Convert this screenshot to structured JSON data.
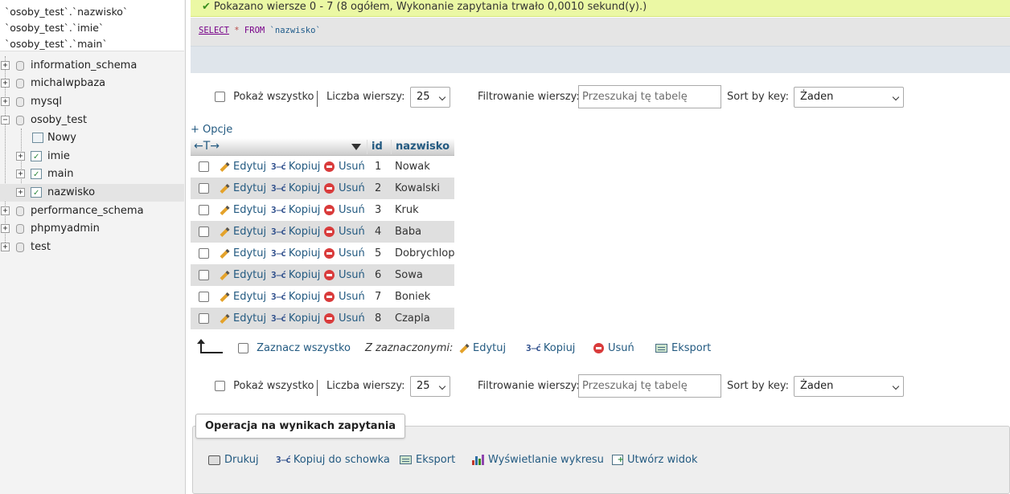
{
  "recent": [
    "`osoby_test`.`nazwisko`",
    "`osoby_test`.`imie`",
    "`osoby_test`.`main`"
  ],
  "tree": {
    "databases": [
      "information_schema",
      "michalwpbaza",
      "mysql",
      "osoby_test",
      "performance_schema",
      "phpmyadmin",
      "test"
    ],
    "new_label": "Nowy",
    "tables": [
      "imie",
      "main",
      "nazwisko"
    ]
  },
  "message": "Pokazano wiersze 0 - 7 (8 ogółem, Wykonanie zapytania trwało 0,0010 sekund(y).)",
  "sql": {
    "select": "SELECT",
    "star": "*",
    "from": "FROM",
    "table": "`nazwisko`"
  },
  "toolbar": {
    "show_all": "Pokaż wszystko",
    "rows_label": "Liczba wierszy:",
    "rows_value": "25",
    "filter_label": "Filtrowanie wierszy:",
    "filter_placeholder": "Przeszukaj tę tabelę",
    "sort_label": "Sort by key:",
    "sort_value": "Żaden"
  },
  "options_link": "+ Opcje",
  "table": {
    "columns": [
      "id",
      "nazwisko"
    ],
    "actions": {
      "edit": "Edytuj",
      "copy": "Kopiuj",
      "delete": "Usuń"
    },
    "rows": [
      {
        "id": "1",
        "nazwisko": "Nowak"
      },
      {
        "id": "2",
        "nazwisko": "Kowalski"
      },
      {
        "id": "3",
        "nazwisko": "Kruk"
      },
      {
        "id": "4",
        "nazwisko": "Baba"
      },
      {
        "id": "5",
        "nazwisko": "Dobrychlop"
      },
      {
        "id": "6",
        "nazwisko": "Sowa"
      },
      {
        "id": "7",
        "nazwisko": "Boniek"
      },
      {
        "id": "8",
        "nazwisko": "Czapla"
      }
    ]
  },
  "with_selected": {
    "select_all": "Zaznacz wszystko",
    "label": "Z zaznaczonymi:",
    "edit": "Edytuj",
    "copy": "Kopiuj",
    "delete": "Usuń",
    "export": "Eksport"
  },
  "operations": {
    "title": "Operacja na wynikach zapytania",
    "print": "Drukuj",
    "copy_clipboard": "Kopiuj do schowka",
    "export": "Eksport",
    "chart": "Wyświetlanie wykresu",
    "create_view": "Utwórz widok"
  },
  "colors": {
    "link": "#235a81",
    "success_bg": "#ebf8a4",
    "delete": "#d93b3b"
  }
}
